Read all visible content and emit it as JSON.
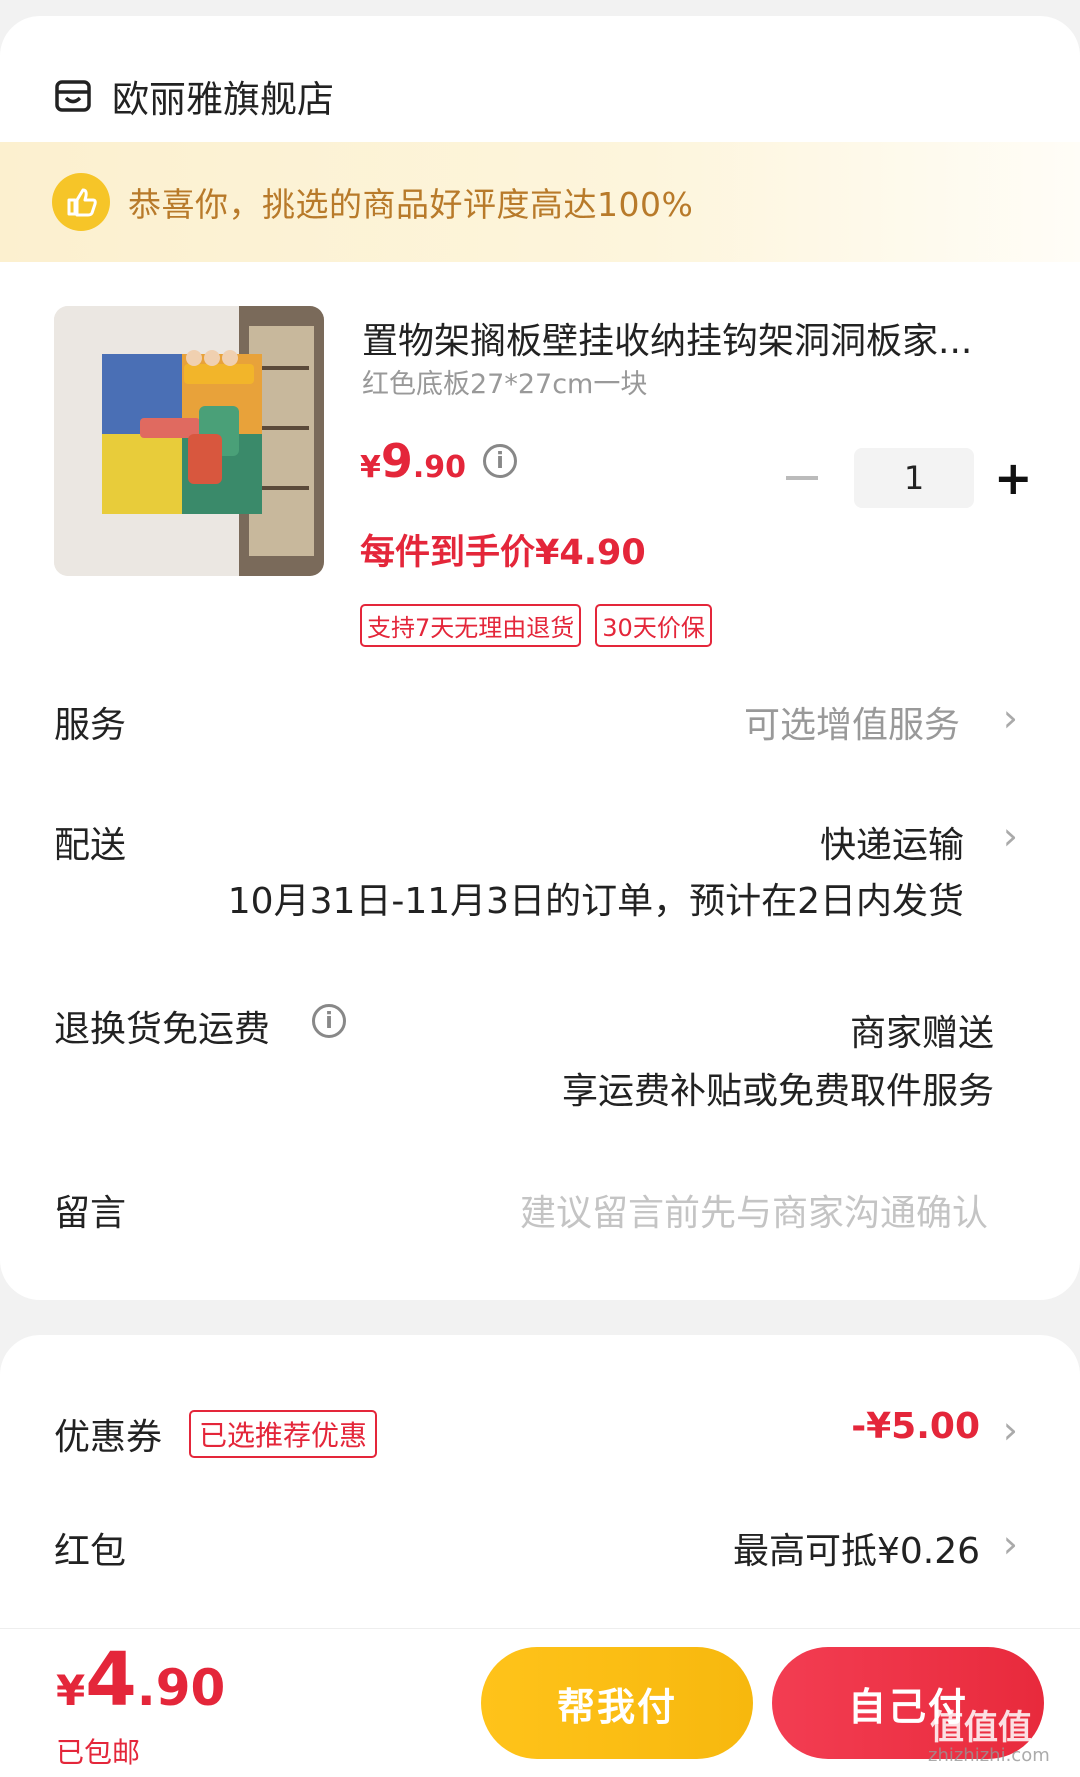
{
  "store": {
    "name": "欧丽雅旗舰店",
    "icon": "store-icon"
  },
  "banner": {
    "text": "恭喜你，挑选的商品好评度高达100%",
    "icon": "thumbs-up-icon"
  },
  "product": {
    "title": "置物架搁板壁挂收纳挂钩架洞洞板家...",
    "spec": "红色底板27*27cm一块",
    "price_yen": "¥",
    "price_int": "9",
    "price_dec": ".90",
    "final_price": "每件到手价¥4.90",
    "quantity": "1",
    "tags": [
      "支持7天无理由退货",
      "30天价保"
    ]
  },
  "rows": {
    "service": {
      "label": "服务",
      "value": "可选增值服务"
    },
    "delivery": {
      "label": "配送",
      "value": "快递运输",
      "note": "10月31日-11月3日的订单，预计在2日内发货"
    },
    "return_ship": {
      "label": "退换货免运费",
      "value": "商家赠送",
      "note": "享运费补贴或免费取件服务"
    },
    "message": {
      "label": "留言",
      "placeholder": "建议留言前先与商家沟通确认"
    },
    "coupon": {
      "label": "优惠券",
      "badge": "已选推荐优惠",
      "value": "-¥5.00"
    },
    "red_packet": {
      "label": "红包",
      "value": "最高可抵¥0.26"
    }
  },
  "footer": {
    "total_yen": "¥",
    "total_int": "4",
    "total_dec": ".90",
    "shipping": "已包邮",
    "help_pay": "帮我付",
    "self_pay": "自己付"
  },
  "watermark": {
    "main": "值值值",
    "sub": "zhizhizhi.com"
  },
  "colors": {
    "accent_red": "#e4263a",
    "gold": "#f6c528",
    "banner_text": "#b87a2a"
  }
}
